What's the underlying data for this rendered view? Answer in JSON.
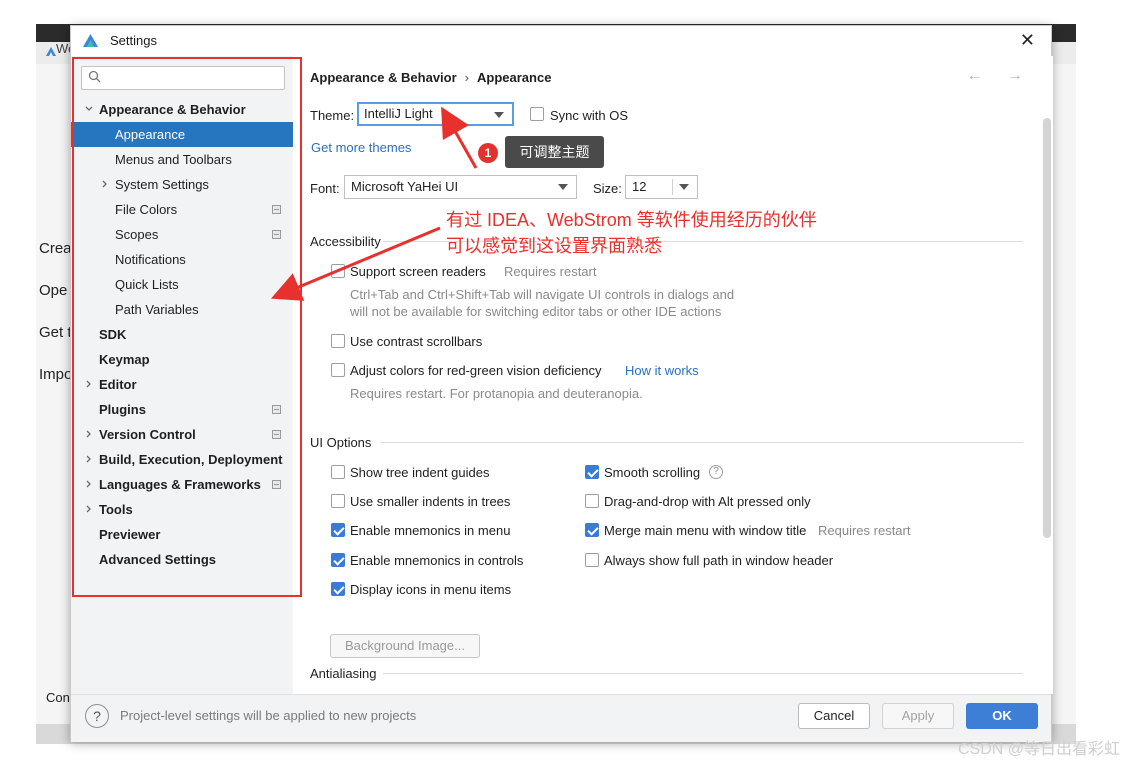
{
  "background_window": {
    "tab_label": "We",
    "items": [
      "Crea",
      "Ope",
      "Get t",
      "Impo"
    ],
    "bottom_label": "Con"
  },
  "dialog": {
    "title": "Settings",
    "close_glyph": "✕"
  },
  "sidebar": {
    "search_placeholder": "",
    "items": [
      {
        "label": "Appearance & Behavior",
        "bold": true,
        "expanded": true
      },
      {
        "label": "Appearance",
        "selected": true
      },
      {
        "label": "Menus and Toolbars"
      },
      {
        "label": "System Settings",
        "collapsed_child": true
      },
      {
        "label": "File Colors",
        "module": true
      },
      {
        "label": "Scopes",
        "module": true
      },
      {
        "label": "Notifications"
      },
      {
        "label": "Quick Lists"
      },
      {
        "label": "Path Variables"
      },
      {
        "label": "SDK",
        "bold": true
      },
      {
        "label": "Keymap",
        "bold": true
      },
      {
        "label": "Editor",
        "bold": true,
        "collapsed": true
      },
      {
        "label": "Plugins",
        "bold": true,
        "module": true
      },
      {
        "label": "Version Control",
        "bold": true,
        "collapsed": true,
        "module": true
      },
      {
        "label": "Build, Execution, Deployment",
        "bold": true,
        "collapsed": true
      },
      {
        "label": "Languages & Frameworks",
        "bold": true,
        "collapsed": true,
        "module": true
      },
      {
        "label": "Tools",
        "bold": true,
        "collapsed": true
      },
      {
        "label": "Previewer",
        "bold": true
      },
      {
        "label": "Advanced Settings",
        "bold": true
      }
    ]
  },
  "content": {
    "breadcrumb": [
      "Appearance & Behavior",
      "Appearance"
    ],
    "breadcrumb_sep": "›",
    "nav_arrows": "← →",
    "theme_label": "Theme:",
    "theme_value": "IntelliJ Light",
    "sync_os_label": "Sync with OS",
    "get_more_themes": "Get more themes",
    "font_label": "Font:",
    "font_value": "Microsoft YaHei UI",
    "size_label": "Size:",
    "size_value": "12",
    "accessibility": {
      "title": "Accessibility",
      "screen_readers": "Support screen readers",
      "screen_readers_hint": "Requires restart",
      "screen_readers_desc1": "Ctrl+Tab and Ctrl+Shift+Tab will navigate UI controls in dialogs and",
      "screen_readers_desc2": "will not be available for switching editor tabs or other IDE actions",
      "contrast_scrollbars": "Use contrast scrollbars",
      "adjust_colors": "Adjust colors for red-green vision deficiency",
      "how_it_works": "How it works",
      "adjust_colors_hint": "Requires restart. For protanopia and deuteranopia."
    },
    "ui_options": {
      "title": "UI Options",
      "left": [
        {
          "label": "Show tree indent guides",
          "checked": false
        },
        {
          "label": "Use smaller indents in trees",
          "checked": false
        },
        {
          "label": "Enable mnemonics in menu",
          "checked": true
        },
        {
          "label": "Enable mnemonics in controls",
          "checked": true
        },
        {
          "label": "Display icons in menu items",
          "checked": true
        }
      ],
      "right": [
        {
          "label": "Smooth scrolling",
          "checked": true
        },
        {
          "label": "Drag-and-drop with Alt pressed only",
          "checked": false
        },
        {
          "label": "Merge main menu with window title",
          "checked": true,
          "hint": "Requires restart"
        },
        {
          "label": "Always show full path in window header",
          "checked": false
        }
      ],
      "background_image_button": "Background Image..."
    },
    "antialiasing_title": "Antialiasing"
  },
  "footer": {
    "help_glyph": "?",
    "info": "Project-level settings will be applied to new projects",
    "cancel": "Cancel",
    "apply": "Apply",
    "ok": "OK"
  },
  "annotations": {
    "badge_number": "1",
    "tooltip": "可调整主题",
    "note_line1": "有过 IDEA、WebStrom 等软件使用经历的伙伴",
    "note_line2": "可以感觉到这设置界面熟悉",
    "color": "#e8302d"
  },
  "watermark": "CSDN @等日出看彩虹"
}
